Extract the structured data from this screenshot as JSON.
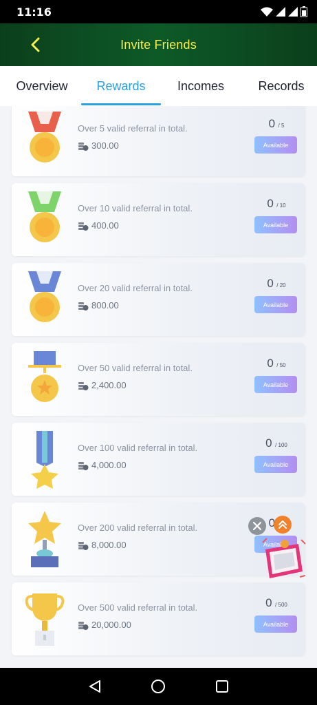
{
  "status_bar": {
    "time": "11:16"
  },
  "header": {
    "title": "Invite Friends"
  },
  "tabs": [
    {
      "label": "Overview"
    },
    {
      "label": "Rewards"
    },
    {
      "label": "Incomes"
    },
    {
      "label": "Records"
    }
  ],
  "active_tab": "Rewards",
  "rewards": [
    {
      "description": "Over 5 valid referral in total.",
      "amount": "300.00",
      "current": "0",
      "total": "/ 5",
      "status": "Available",
      "badge": "red-ribbon-medal-icon"
    },
    {
      "description": "Over 10 valid referral in total.",
      "amount": "400.00",
      "current": "0",
      "total": "/ 10",
      "status": "Available",
      "badge": "green-ribbon-medal-icon"
    },
    {
      "description": "Over 20 valid referral in total.",
      "amount": "800.00",
      "current": "0",
      "total": "/ 20",
      "status": "Available",
      "badge": "blue-ribbon-medal-icon"
    },
    {
      "description": "Over 50 valid referral in total.",
      "amount": "2,400.00",
      "current": "0",
      "total": "/ 50",
      "status": "Available",
      "badge": "star-medal-icon"
    },
    {
      "description": "Over 100 valid referral in total.",
      "amount": "4,000.00",
      "current": "0",
      "total": "/ 100",
      "status": "Available",
      "badge": "star-ribbon-icon"
    },
    {
      "description": "Over 200 valid referral in total.",
      "amount": "8,000.00",
      "current": "0",
      "total": "/ 2",
      "status": "Available",
      "badge": "star-trophy-icon"
    },
    {
      "description": "Over 500 valid referral in total.",
      "amount": "20,000.00",
      "current": "0",
      "total": "/ 500",
      "status": "Available",
      "badge": "gold-cup-icon"
    }
  ],
  "colors": {
    "header_bg": "#0d5a27",
    "header_title": "#f3f04f",
    "accent": "#2aa0dc",
    "button_gradient_start": "#8fc0ff",
    "button_gradient_end": "#b48ef0"
  },
  "floating": {
    "close_icon": "close-icon",
    "up_icon": "double-chevron-up-icon",
    "gift_icon": "gift-box-icon"
  },
  "nav": [
    "back-triangle-icon",
    "home-circle-icon",
    "recents-square-icon"
  ]
}
